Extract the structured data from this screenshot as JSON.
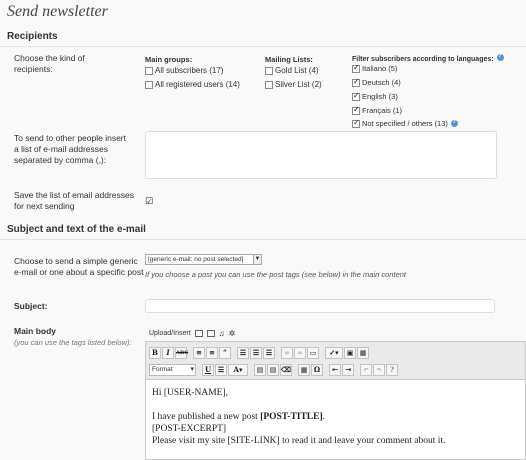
{
  "page": {
    "title": "Send newsletter"
  },
  "recipients": {
    "section_title": "Recipients",
    "kind_label": "Choose the kind of recipients:",
    "main_groups": {
      "heading": "Main groups:",
      "options": [
        {
          "label": "All subscribers (17)",
          "checked": false
        },
        {
          "label": "All registered users (14)",
          "checked": false
        }
      ]
    },
    "mailing_lists": {
      "heading": "Mailing Lists:",
      "options": [
        {
          "label": "Gold List (4)",
          "checked": false
        },
        {
          "label": "Silver List (2)",
          "checked": false
        }
      ]
    },
    "languages": {
      "heading": "Filter subscribers according to languages:",
      "options": [
        {
          "label": "Italiano (5)",
          "checked": true
        },
        {
          "label": "Deutsch (4)",
          "checked": true
        },
        {
          "label": "English (3)",
          "checked": true
        },
        {
          "label": "Français (1)",
          "checked": true
        },
        {
          "label": "Not specified / others (13)",
          "checked": true
        }
      ]
    },
    "other_emails_label": "To send to other people insert a list of e-mail addresses separated by comma (,):",
    "save_list_label": "Save the list of email addresses for next sending",
    "save_list_checked": true
  },
  "subject_text": {
    "section_title": "Subject and text of the e-mail",
    "post_choice_label": "Choose to send a simple generic e-mail or one about a specific post",
    "post_select_value": "[generic e-mail: no post selected]",
    "post_hint": "If you choose a post you can use the post tags (see below) in the main content",
    "subject_label": "Subject:",
    "subject_value": "",
    "body_label": "Main body",
    "body_sublabel": "(you can use the tags listed below):",
    "upload_label": "Upload/Insert",
    "format_label": "Format",
    "body_lines": {
      "greeting": "Hi [USER-NAME],",
      "published_prefix": "I have published a new post ",
      "published_tag": "[POST-TITLE]",
      "published_suffix": ".",
      "excerpt": "[POST-EXCERPT]",
      "visit": "Please visit my site [SITE-LINK] to read it and leave your comment about it."
    }
  },
  "colors": {
    "accent": "#5a8fd0",
    "background": "#f9f9f9"
  }
}
